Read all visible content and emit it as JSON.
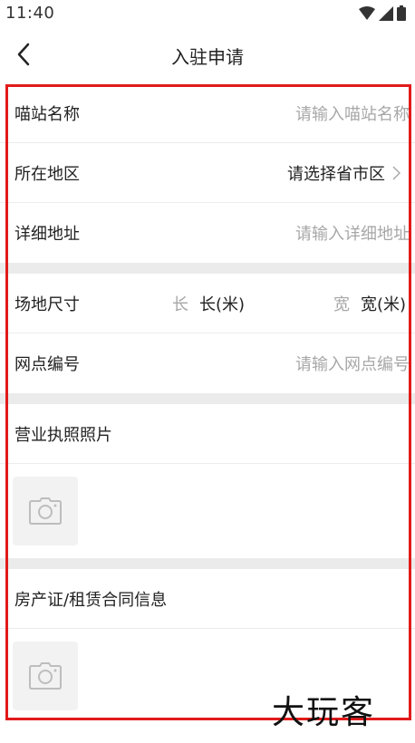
{
  "status_bar": {
    "time": "11:40",
    "icons": [
      "wifi-icon",
      "signal-icon",
      "battery-icon"
    ]
  },
  "nav": {
    "title": "入驻申请",
    "back_icon": "chevron-left-icon"
  },
  "form": {
    "name_label": "喵站名称",
    "name_placeholder": "请输入喵站名称",
    "region_label": "所在地区",
    "region_value": "请选择省市区",
    "address_label": "详细地址",
    "address_placeholder": "请输入详细地址",
    "size_label": "场地尺寸",
    "length_prefix": "长",
    "length_unit": "长(米)",
    "width_prefix": "宽",
    "width_unit": "宽(米)",
    "outlet_label": "网点编号",
    "outlet_placeholder": "请输入网点编号",
    "license_label": "营业执照照片",
    "property_label": "房产证/租赁合同信息"
  },
  "watermark": "大玩客",
  "colors": {
    "highlight": "#e21a1a",
    "placeholder": "#a7a7a7",
    "divider": "#ebebeb"
  }
}
